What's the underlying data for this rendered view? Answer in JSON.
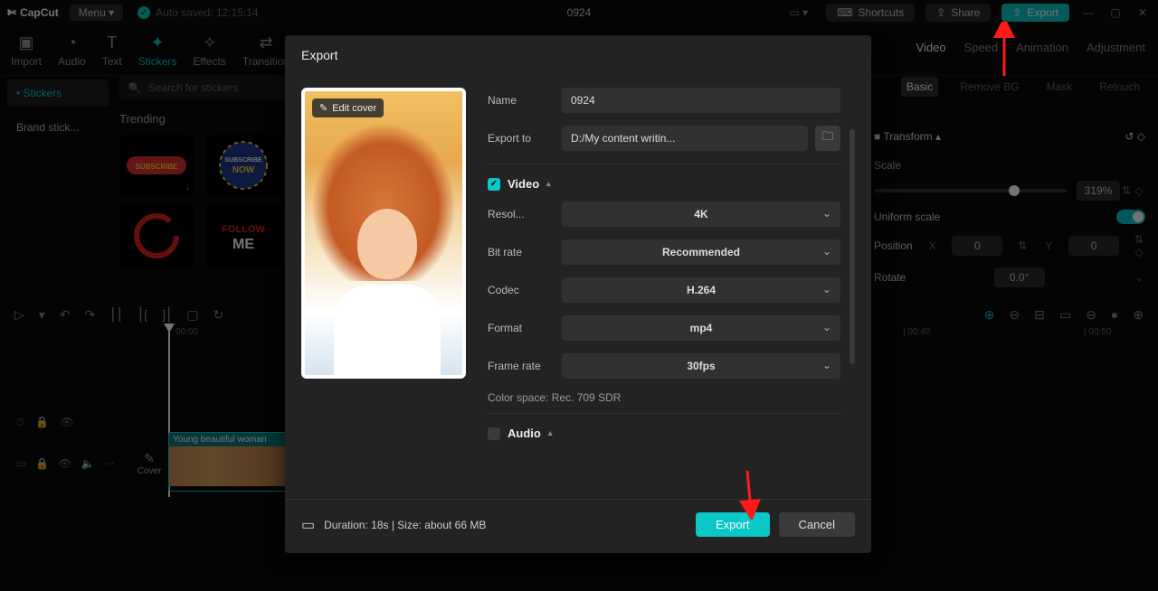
{
  "titlebar": {
    "app": "CapCut",
    "menu": "Menu",
    "autosave": "Auto saved: 12:15:14",
    "project": "0924",
    "shortcuts": "Shortcuts",
    "share": "Share",
    "export": "Export"
  },
  "toptabs": {
    "import": "Import",
    "audio": "Audio",
    "text": "Text",
    "stickers": "Stickers",
    "effects": "Effects",
    "transition": "Transition"
  },
  "leftside": {
    "stickers": "Stickers",
    "brand": "Brand stick..."
  },
  "stickers": {
    "search_ph": "Search for stickers",
    "trending": "Trending"
  },
  "rtabs": {
    "video": "Video",
    "speed": "Speed",
    "animation": "Animation",
    "adjustment": "Adjustment"
  },
  "subtabs": {
    "basic": "Basic",
    "removebg": "Remove BG",
    "mask": "Mask",
    "retouch": "Retouch"
  },
  "rprops": {
    "transform": "Transform",
    "scale": "Scale",
    "scale_val": "319%",
    "uniform": "Uniform scale",
    "position": "Position",
    "x": "X",
    "xval": "0",
    "y": "Y",
    "yval": "0",
    "rotate": "Rotate",
    "rotval": "0.0°"
  },
  "timeline": {
    "t0": "00:00",
    "t40": "| 00:40",
    "t50": "| 00:50",
    "clip_title": "Young beautiful woman",
    "cover": "Cover"
  },
  "modal": {
    "title": "Export",
    "editcover": "Edit cover",
    "name_l": "Name",
    "name_v": "0924",
    "exportto_l": "Export to",
    "exportto_v": "D:/My content writin...",
    "video": "Video",
    "resol_l": "Resol...",
    "resol_v": "4K",
    "bitrate_l": "Bit rate",
    "bitrate_v": "Recommended",
    "codec_l": "Codec",
    "codec_v": "H.264",
    "format_l": "Format",
    "format_v": "mp4",
    "fr_l": "Frame rate",
    "fr_v": "30fps",
    "colorspace": "Color space: Rec. 709 SDR",
    "audio": "Audio",
    "duration": "Duration: 18s | Size: about 66 MB",
    "export_btn": "Export",
    "cancel_btn": "Cancel"
  }
}
